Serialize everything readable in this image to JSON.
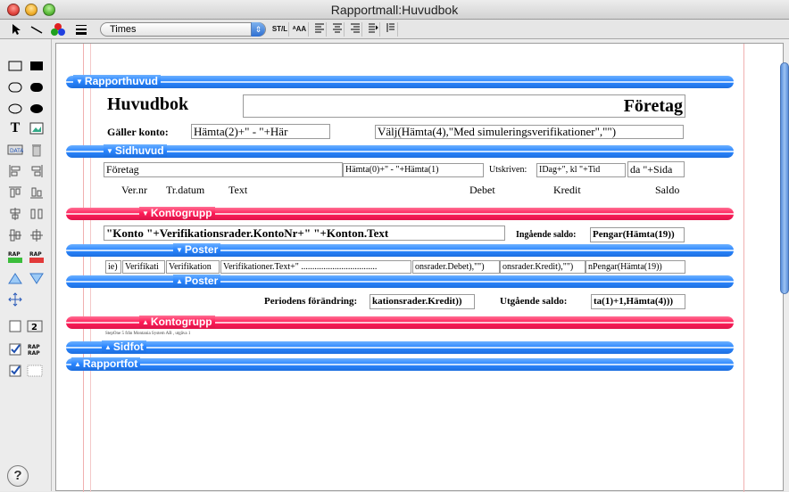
{
  "window": {
    "title": "Rapportmall:Huvudbok"
  },
  "toolbar": {
    "font_value": "Times",
    "style_button": "ST/L",
    "size_button": "ᴬAA"
  },
  "sections": {
    "rapporthuvud": "Rapporthuvud",
    "sidhuvud": "Sidhuvud",
    "kontogrupp_top": "Kontogrupp",
    "poster_top": "Poster",
    "poster_bottom": "Poster",
    "kontogrupp_bottom": "Kontogrupp",
    "sidfot": "Sidfot",
    "rapportfot": "Rapportfot"
  },
  "report_header": {
    "title": "Huvudbok",
    "company": "Företag",
    "account_label": "Gäller konto:",
    "account_field": "Hämta(2)+\" - \"+Här",
    "sim_field": "Välj(Hämta(4),\"Med simuleringsverifikationer\",\"\")"
  },
  "page_header": {
    "company_field": "Företag",
    "period_field": "Hämta(0)+\" - \"+Hämta(1)",
    "printed_label": "Utskriven:",
    "date_field": "IDag+\", kl \"+Tid",
    "page_field": "da \"+Sida",
    "columns": [
      "Ver.nr",
      "Tr.datum",
      "Text",
      "Debet",
      "Kredit",
      "Saldo"
    ]
  },
  "account_group": {
    "account_field": "\"Konto  \"+Verifikationsrader.KontoNr+\"  \"+Konton.Text",
    "opening_label": "Ingående saldo:",
    "opening_field": "Pengar(Hämta(19))"
  },
  "posts": {
    "fields": [
      "ie)",
      "Verifikati",
      "Verifikation",
      "Verifikationer.Text+\" ..................................",
      "onsrader.Debet),\"\")",
      "onsrader.Kredit),\"\")",
      "nPengar(Hämta(19))"
    ]
  },
  "account_footer": {
    "change_label": "Periodens förändring:",
    "change_field": "kationsrader.Kredit))",
    "closing_label": "Utgående saldo:",
    "closing_field": "ta(1)+1,Hämta(4)))"
  },
  "footer_note": "StepOne 5 från Montania System AB , utgåva 1",
  "colors": {
    "blue_band": "#2a86ff",
    "red_band": "#ff1d58"
  },
  "icons": [
    "arrow-tool-icon",
    "line-tool-icon",
    "color-tool-icon",
    "line-weight-icon",
    "rectangle-icon",
    "filled-rectangle-icon",
    "rounded-rect-icon",
    "filled-rounded-rect-icon",
    "oval-icon",
    "filled-oval-icon",
    "text-tool-icon",
    "picture-tool-icon",
    "data-field-icon",
    "trash-icon",
    "help-icon"
  ]
}
